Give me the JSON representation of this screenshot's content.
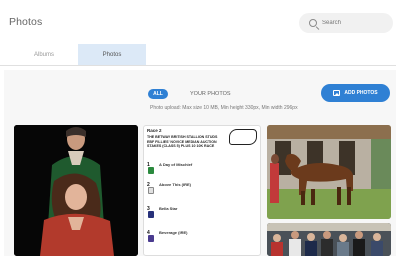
{
  "header": {
    "title": "Photos",
    "search_placeholder": "Search"
  },
  "tabs": [
    {
      "label": "Albums"
    },
    {
      "label": "Photos",
      "active": true
    }
  ],
  "filter": {
    "all_label": "ALL",
    "your_photos_label": "YOUR PHOTOS"
  },
  "add_photos_label": "ADD PHOTOS",
  "upload_info": "Photo upload: Max size 10 MB, Min height 330px, Min width 296px",
  "race_card": {
    "race_label": "Race 2",
    "heading": "THE BETWAY BRITISH STALLION STUDS EBF FILLIES' NOVICE MEDIAN AUCTION STAKES (CLASS 5) PLUS 10 10K RACE",
    "runners": [
      {
        "number": "1",
        "name": "A Day of Mischief"
      },
      {
        "number": "2",
        "name": "Above This (IRE)"
      },
      {
        "number": "3",
        "name": "Bella Star"
      },
      {
        "number": "4",
        "name": "Beverage (IRE)"
      }
    ]
  },
  "colors": {
    "accent": "#2f80d4",
    "tab_active_bg": "#dce9f7"
  }
}
